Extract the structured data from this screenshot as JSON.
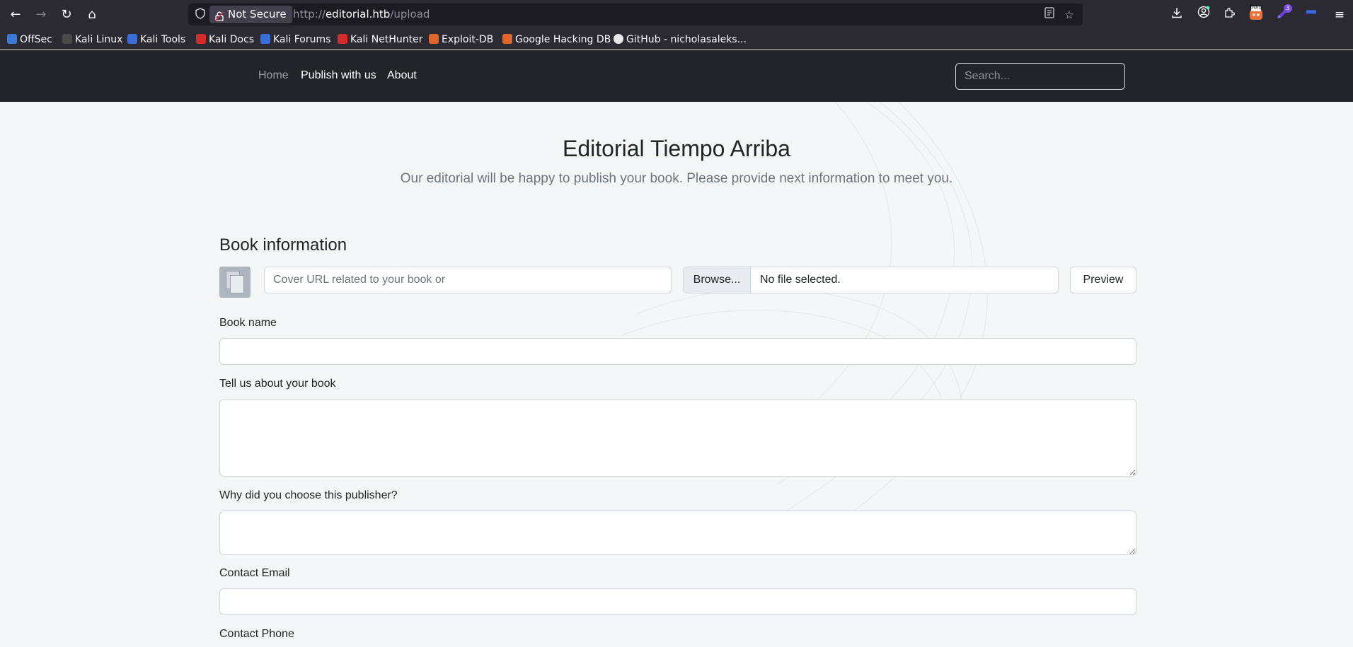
{
  "browser": {
    "not_secure_label": "Not Secure",
    "url_scheme": "http://",
    "url_host": "editorial.htb",
    "url_path": "/upload",
    "burp_badge": "burp",
    "ext_badge": "3",
    "bookmarks": [
      {
        "label": "OffSec",
        "color": "#3a7bd5"
      },
      {
        "label": "Kali Linux",
        "color": "#4a4a4a"
      },
      {
        "label": "Kali Tools",
        "color": "#3b6fd8"
      },
      {
        "label": "Kali Docs",
        "color": "#d42b2b"
      },
      {
        "label": "Kali Forums",
        "color": "#3b6fd8"
      },
      {
        "label": "Kali NetHunter",
        "color": "#d42b2b"
      },
      {
        "label": "Exploit-DB",
        "color": "#e0662b"
      },
      {
        "label": "Google Hacking DB",
        "color": "#e0662b"
      },
      {
        "label": "GitHub - nicholasaleks...",
        "color": "#e8e8e8"
      }
    ]
  },
  "navbar": {
    "home": "Home",
    "publish": "Publish with us",
    "about": "About",
    "search_placeholder": "Search..."
  },
  "header": {
    "title": "Editorial Tiempo Arriba",
    "subtitle": "Our editorial will be happy to publish your book. Please provide next information to meet you."
  },
  "form": {
    "section_title": "Book information",
    "cover_url_placeholder": "Cover URL related to your book or",
    "browse_label": "Browse...",
    "file_status": "No file selected.",
    "preview_label": "Preview",
    "book_name_label": "Book name",
    "about_label": "Tell us about your book",
    "why_label": "Why did you choose this publisher?",
    "email_label": "Contact Email",
    "phone_label": "Contact Phone"
  }
}
